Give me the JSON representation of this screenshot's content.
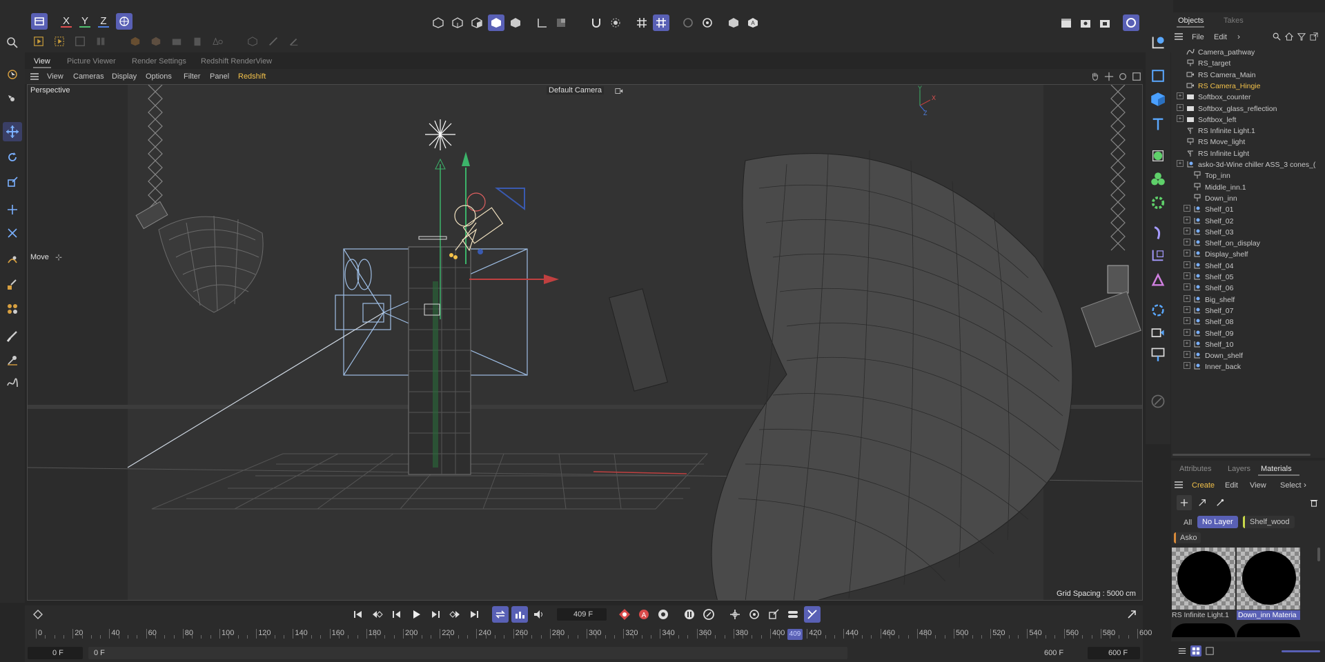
{
  "topbar": {
    "axes": [
      "X",
      "Y",
      "Z"
    ],
    "viewport_tabs": [
      "View",
      "Picture Viewer",
      "Render Settings",
      "Redshift RenderView"
    ]
  },
  "viewport_menu": [
    "View",
    "Cameras",
    "Display",
    "Options",
    "Filter",
    "Panel",
    "Redshift"
  ],
  "viewport": {
    "name": "Perspective",
    "camera": "Default Camera",
    "tool_label": "Move",
    "grid_spacing": "Grid Spacing : 5000 cm"
  },
  "objects_panel": {
    "tabs": [
      "Objects",
      "Takes"
    ],
    "menu": [
      "File",
      "Edit"
    ],
    "items": [
      {
        "label": "Camera_pathway",
        "indent": 0,
        "expander": false,
        "icon": "spline-icon",
        "highlight": false
      },
      {
        "label": "RS_target",
        "indent": 0,
        "expander": false,
        "icon": "target-icon",
        "highlight": false
      },
      {
        "label": "RS Camera_Main",
        "indent": 0,
        "expander": false,
        "icon": "camera-icon",
        "highlight": false
      },
      {
        "label": "RS Camera_Hingie",
        "indent": 0,
        "expander": false,
        "icon": "camera-icon",
        "highlight": true
      },
      {
        "label": "Softbox_counter",
        "indent": 0,
        "expander": true,
        "icon": "folder-icon",
        "highlight": false
      },
      {
        "label": "Softbox_glass_reflection",
        "indent": 0,
        "expander": true,
        "icon": "folder-icon",
        "highlight": false
      },
      {
        "label": "Softbox_left",
        "indent": 0,
        "expander": true,
        "icon": "folder-icon",
        "highlight": false
      },
      {
        "label": "RS Infinite Light.1",
        "indent": 0,
        "expander": false,
        "icon": "light-icon",
        "highlight": false
      },
      {
        "label": "RS Move_light",
        "indent": 0,
        "expander": false,
        "icon": "target-icon",
        "highlight": false
      },
      {
        "label": "RS Infinite Light",
        "indent": 0,
        "expander": false,
        "icon": "light-icon",
        "highlight": false
      },
      {
        "label": "asko-3d-Wine chiller ASS_3 cones_(",
        "indent": 0,
        "expander": true,
        "icon": "null-icon",
        "highlight": false
      },
      {
        "label": "Top_inn",
        "indent": 1,
        "expander": false,
        "icon": "pin-icon",
        "highlight": false
      },
      {
        "label": "Middle_inn.1",
        "indent": 1,
        "expander": false,
        "icon": "pin-icon",
        "highlight": false
      },
      {
        "label": "Down_inn",
        "indent": 1,
        "expander": false,
        "icon": "pin-icon",
        "highlight": false
      },
      {
        "label": "Shelf_01",
        "indent": 1,
        "expander": true,
        "icon": "null-icon",
        "highlight": false
      },
      {
        "label": "Shelf_02",
        "indent": 1,
        "expander": true,
        "icon": "null-icon",
        "highlight": false
      },
      {
        "label": "Shelf_03",
        "indent": 1,
        "expander": true,
        "icon": "null-icon",
        "highlight": false
      },
      {
        "label": "Shelf_on_display",
        "indent": 1,
        "expander": true,
        "icon": "null-icon",
        "highlight": false
      },
      {
        "label": "Display_shelf",
        "indent": 1,
        "expander": true,
        "icon": "null-icon",
        "highlight": false
      },
      {
        "label": "Shelf_04",
        "indent": 1,
        "expander": true,
        "icon": "null-icon",
        "highlight": false
      },
      {
        "label": "Shelf_05",
        "indent": 1,
        "expander": true,
        "icon": "null-icon",
        "highlight": false
      },
      {
        "label": "Shelf_06",
        "indent": 1,
        "expander": true,
        "icon": "null-icon",
        "highlight": false
      },
      {
        "label": "Big_shelf",
        "indent": 1,
        "expander": true,
        "icon": "null-icon",
        "highlight": false
      },
      {
        "label": "Shelf_07",
        "indent": 1,
        "expander": true,
        "icon": "null-icon",
        "highlight": false
      },
      {
        "label": "Shelf_08",
        "indent": 1,
        "expander": true,
        "icon": "null-icon",
        "highlight": false
      },
      {
        "label": "Shelf_09",
        "indent": 1,
        "expander": true,
        "icon": "null-icon",
        "highlight": false
      },
      {
        "label": "Shelf_10",
        "indent": 1,
        "expander": true,
        "icon": "null-icon",
        "highlight": false
      },
      {
        "label": "Down_shelf",
        "indent": 1,
        "expander": true,
        "icon": "null-icon",
        "highlight": false
      },
      {
        "label": "Inner_back",
        "indent": 1,
        "expander": true,
        "icon": "null-icon",
        "highlight": false
      }
    ]
  },
  "materials_panel": {
    "tabs": [
      "Attributes",
      "Layers",
      "Materials"
    ],
    "menu": [
      "Create",
      "Edit",
      "View",
      "Select"
    ],
    "filters": [
      "All",
      "No Layer",
      "Shelf_wood",
      "Asko"
    ],
    "materials": [
      {
        "label": "RS Infinite Light.1",
        "selected": false
      },
      {
        "label": "Down_inn Materia",
        "selected": true
      }
    ]
  },
  "timeline": {
    "current_frame": "409 F",
    "playhead": "409",
    "ticks": [
      "0",
      "20",
      "40",
      "60",
      "80",
      "100",
      "120",
      "140",
      "160",
      "180",
      "200",
      "220",
      "240",
      "260",
      "280",
      "300",
      "320",
      "340",
      "360",
      "380",
      "400",
      "420",
      "440",
      "460",
      "480",
      "500",
      "520",
      "540",
      "560",
      "580",
      "600"
    ],
    "start_field": "0 F",
    "min_field": "0 F",
    "max_field": "600 F",
    "end_field": "600 F"
  },
  "colors": {
    "accent": "#5960b5",
    "highlight_text": "#f2c14a",
    "x_axis": "#e05050",
    "y_axis": "#50c070",
    "z_axis": "#5080e0"
  }
}
